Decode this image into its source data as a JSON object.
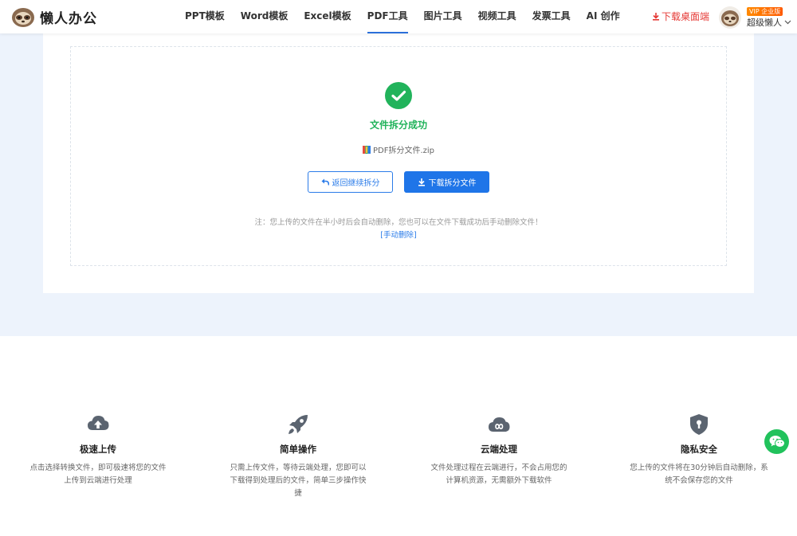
{
  "header": {
    "logo_text": "懒人办公",
    "nav": [
      {
        "label": "PPT模板"
      },
      {
        "label": "Word模板"
      },
      {
        "label": "Excel模板"
      },
      {
        "label": "PDF工具"
      },
      {
        "label": "图片工具"
      },
      {
        "label": "视频工具"
      },
      {
        "label": "发票工具"
      },
      {
        "label": "AI 创作"
      }
    ],
    "active_nav": "PDF工具",
    "download_client": "下载桌面端",
    "vip_badge": "VIP 企业版",
    "user_name": "超级懒人"
  },
  "result": {
    "success_text": "文件拆分成功",
    "file_name": "PDF拆分文件.zip",
    "back_button": "返回继续拆分",
    "download_button": "下载拆分文件",
    "note": "注：您上传的文件在半小时后会自动删除，您也可以在文件下载成功后手动删除文件！",
    "manual_delete": "[手动删除]"
  },
  "features": [
    {
      "icon": "cloud-upload-icon",
      "title": "极速上传",
      "desc": [
        "点击选择转换文件，即可极速将您的文件",
        "上传到云端进行处理"
      ]
    },
    {
      "icon": "rocket-icon",
      "title": "简单操作",
      "desc": [
        "只需上传文件，等待云端处理，您即可以",
        "下载得到处理后的文件，简单三步操作快",
        "捷"
      ]
    },
    {
      "icon": "cloud-processing-icon",
      "title": "云端处理",
      "desc": [
        "文件处理过程在云端进行，不会占用您的",
        "计算机资源，无需额外下载软件"
      ]
    },
    {
      "icon": "privacy-shield-icon",
      "title": "隐私安全",
      "desc": [
        "您上传的文件将在30分钟后自动删除，系",
        "统不会保存您的文件"
      ]
    }
  ],
  "colors": {
    "accent": "#1f75e8",
    "success": "#21b35b",
    "danger": "#e53935",
    "background": "#edf3fc"
  }
}
